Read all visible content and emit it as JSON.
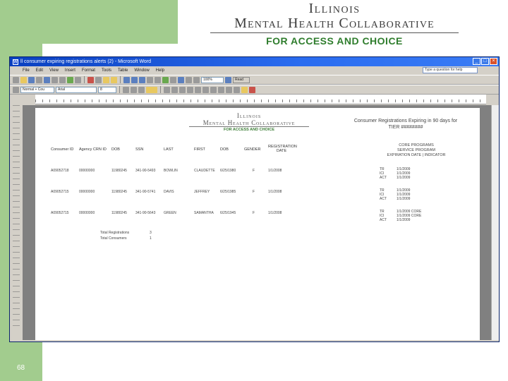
{
  "slide": {
    "number": "68",
    "logo": {
      "line1": "Illinois",
      "line2": "Mental Health Collaborative",
      "line3": "FOR ACCESS AND CHOICE"
    }
  },
  "window": {
    "title": "ll consumer expiring registrations alerts (2) - Microsoft Word",
    "menu": [
      "File",
      "Edit",
      "View",
      "Insert",
      "Format",
      "Tools",
      "Table",
      "Window",
      "Help"
    ],
    "help_placeholder": "Type a question for help",
    "style_value": "Normal + Cou",
    "font_value": "Arial",
    "size_value": "8",
    "zoom_value": "100%",
    "read_label": "Read"
  },
  "document": {
    "logo": {
      "line1": "Illinois",
      "line2": "Mental Health Collaborative",
      "line3": "FOR ACCESS AND CHOICE"
    },
    "report_title_line1": "Consumer Registrations Expiring in 90 days for",
    "report_title_line2": "TIER ########",
    "columns": [
      "Consumer ID",
      "Agency CRN ID",
      "DOB",
      "SSN",
      "LAST",
      "FIRST",
      "DOB",
      "GENDER",
      "REGISTRATION DATE"
    ],
    "core_header_line1": "CORE PROGRAMS",
    "core_header_line2": "SERVICE PROGRAM",
    "core_header_line3": "EXPIRATION DATE | INDICATOR",
    "rows": [
      {
        "id": "A09052718",
        "agency": "00000000",
        "code": "11980245",
        "ssn": "341-90-5493",
        "last": "BOWLIN",
        "first": "CLAUDETTE",
        "dob": "6/25/1980",
        "gender": "F",
        "reg": "1/1/2008",
        "core": [
          [
            "TR",
            "1/1/2009"
          ],
          [
            "ICI",
            "1/1/2009"
          ],
          [
            "ACT",
            "1/1/2009"
          ]
        ]
      },
      {
        "id": "A09052715",
        "agency": "00000000",
        "code": "11980245",
        "ssn": "341-90-5741",
        "last": "DAVIS",
        "first": "JEFFREY",
        "dob": "6/25/1985",
        "gender": "F",
        "reg": "1/1/2008",
        "core": [
          [
            "TR",
            "1/1/2009"
          ],
          [
            "ICI",
            "1/1/2009"
          ],
          [
            "ACT",
            "1/1/2009"
          ]
        ]
      },
      {
        "id": "A09052715",
        "agency": "00000000",
        "code": "11980245",
        "ssn": "341-90-5643",
        "last": "GREEN",
        "first": "SAMANTHA",
        "dob": "6/25/1945",
        "gender": "F",
        "reg": "1/1/2008",
        "core": [
          [
            "TR",
            "1/1/2009 CORE"
          ],
          [
            "ICI",
            "1/1/2009 CORE"
          ],
          [
            "ACT",
            "1/1/2009"
          ]
        ]
      }
    ],
    "total_label_1": "Total Registrations",
    "total_value_1": "3",
    "total_label_2": "Total Consumers",
    "total_value_2": "1"
  }
}
